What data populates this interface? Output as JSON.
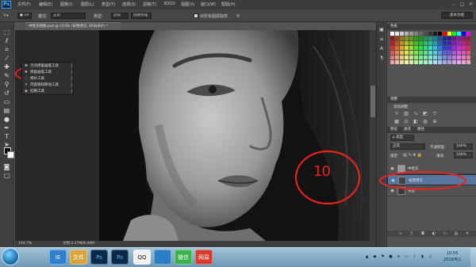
{
  "app": {
    "logo": "Ps"
  },
  "menu": {
    "items": [
      "文件(F)",
      "编辑(E)",
      "图像(I)",
      "图层(L)",
      "类型(Y)",
      "选择(S)",
      "滤镜(T)",
      "3D(D)",
      "视图(V)",
      "窗口(W)",
      "帮助(H)"
    ]
  },
  "window_controls": {
    "minimize": "–",
    "maximize": "□",
    "close": "✕"
  },
  "options": {
    "mode_label": "模式:",
    "mode_value": "正常",
    "type_label": "类型:",
    "type_normal": "近似",
    "type_texture": "创建纹理",
    "sample_label": "对所有图层取样",
    "workspace": "基本功能"
  },
  "document": {
    "tab_title": "中性灰修图.psd @ 110% (背景拷贝, RGB/8#) *",
    "status_zoom": "104.7%",
    "status_doc": "文档:2.27M/8.44M",
    "annotation_number": "10"
  },
  "flyout": {
    "items": [
      {
        "label": "污点修复画笔工具",
        "key": "J"
      },
      {
        "label": "修复画笔工具",
        "key": "J"
      },
      {
        "label": "修补工具",
        "key": "J"
      },
      {
        "label": "内容感知移动工具",
        "key": "J"
      },
      {
        "label": "红眼工具",
        "key": "J"
      }
    ]
  },
  "panels": {
    "swatches_header": "色板",
    "adjust_header": "调整",
    "adjust_subtitle": "添加调整",
    "layers_tabs": [
      "图层",
      "通道",
      "路径"
    ],
    "blend_mode": "正常",
    "opacity_label": "不透明度:",
    "opacity_value": "100%",
    "lock_label": "锁定:",
    "fill_label": "填充:",
    "fill_value": "100%",
    "kind_label": "类型"
  },
  "layers": [
    {
      "name": "中性灰",
      "selected": false
    },
    {
      "name": "背景拷贝",
      "selected": true
    },
    {
      "name": "背景",
      "selected": false
    }
  ],
  "taskbar": {
    "apps": [
      "IE",
      "文件",
      "Ps",
      "Ps",
      "QQ",
      "",
      "微信",
      "网易"
    ],
    "time": "10:55",
    "date": "2016/6/1"
  },
  "colors": {
    "annotation": "#e8231d",
    "selected_layer": "#5875a0",
    "ui_dark": "#3c3c3c"
  }
}
